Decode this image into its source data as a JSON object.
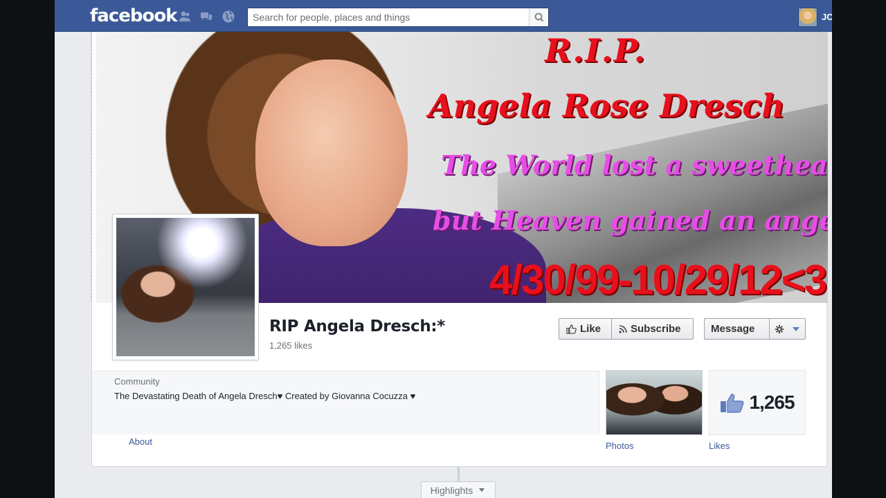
{
  "topbar": {
    "logo": "facebook",
    "search_placeholder": "Search for people, places and things",
    "username": "JC",
    "jewels": [
      "friends-icon",
      "messages-icon",
      "notifications-globe-icon"
    ]
  },
  "cover": {
    "rip": "R.I.P.",
    "name": "Angela Rose Dresch",
    "line1": "The World lost a sweetheart,",
    "line2": "but Heaven gained an angel :*",
    "dates": "4/30/99-10/29/12<3"
  },
  "page": {
    "name": "RIP Angela Dresch:*",
    "likes_text": "1,265 likes"
  },
  "actions": {
    "like": "Like",
    "subscribe": "Subscribe",
    "message": "Message"
  },
  "info": {
    "category": "Community",
    "description": "The Devastating Death of Angela Dresch♥ Created by Giovanna Cocuzza ♥",
    "about": "About"
  },
  "tiles": {
    "photos": "Photos",
    "likes_label": "Likes",
    "likes_count": "1,265"
  },
  "timeline": {
    "highlights": "Highlights"
  },
  "colors": {
    "brand": "#3b5998",
    "cover_red": "#e8101c",
    "cover_pink": "#e74ee6"
  }
}
